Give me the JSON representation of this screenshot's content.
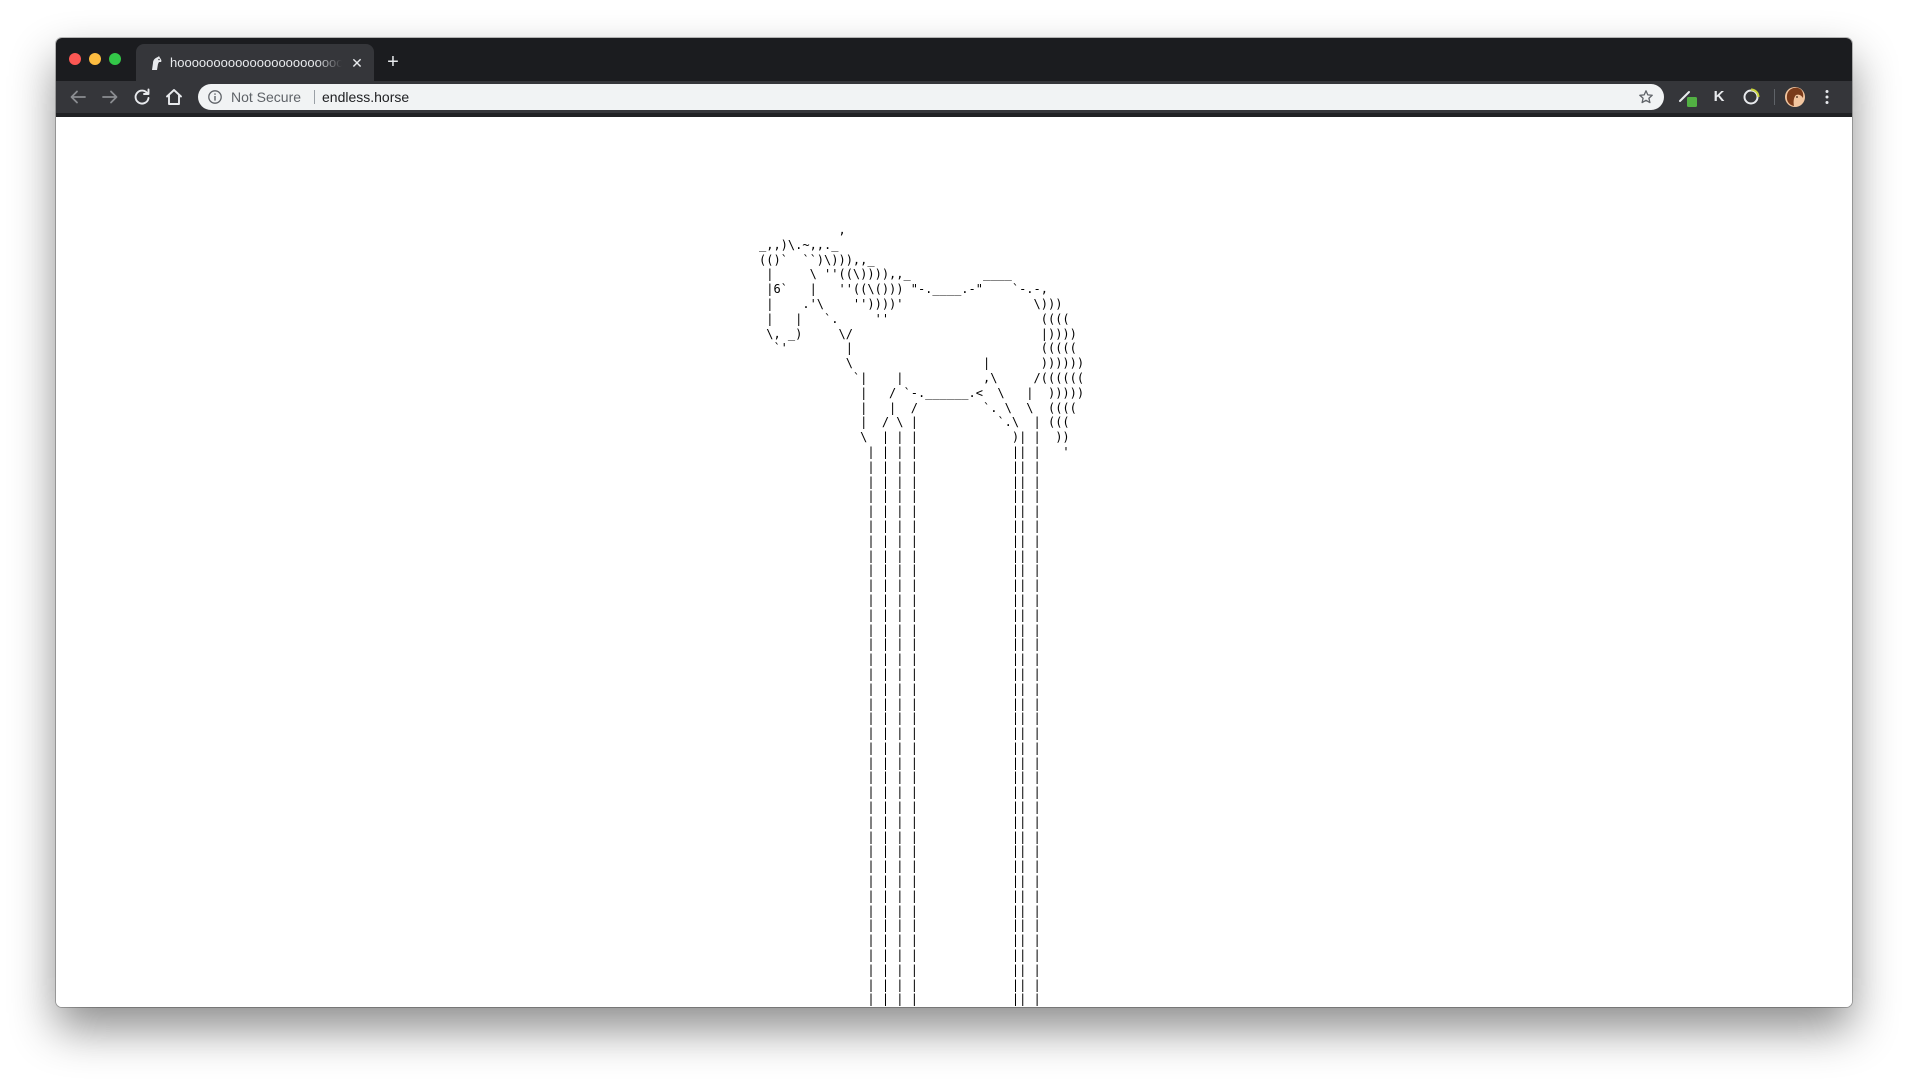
{
  "browser": {
    "tab": {
      "title": "hoooooooooooooooooooooooooooooooooooooooooooooorse",
      "favicon": "horse-head-icon",
      "close_icon": "close-icon"
    },
    "new_tab_icon": "plus-icon",
    "nav": {
      "back_icon": "arrow-left-icon",
      "forward_icon": "arrow-right-icon",
      "reload_icon": "reload-icon",
      "home_icon": "home-icon"
    },
    "omnibox": {
      "security_label": "Not Secure",
      "url": "endless.horse",
      "info_icon": "info-circle-icon",
      "bookmark_icon": "star-icon"
    },
    "extensions": {
      "ext1_icon": "pen-extension-icon",
      "ext2_label": "K",
      "ext3_icon": "circle-refresh-extension-icon",
      "profile_icon": "avatar-icon",
      "menu_icon": "kebab-menu-icon"
    },
    "colors": {
      "titlebar": "#1b1c1f",
      "toolbar": "#35363a",
      "omnibox": "#f1f3f4",
      "close": "#fc5753",
      "minimize": "#fdbc40",
      "maximize": "#33c748"
    }
  },
  "page": {
    "horse_art": "           ,\n_,,)\\.~,,._\n(()`  ``)\\))),,_\n |     \\ ''((\\)))),,_          ____\n |6`   |   ''((\\())) \"-.____.-\"    `-.-,\n |    .'\\    ''))))'                  \\)))\n |   |   `.     ''                     ((((\n \\, _)     \\/                          |))))\n  `'        |                          (((((\n            \\                  |       ))))))\n             `|    |           ,\\     /((((((\n              |   / `-.______.<  \\   |  )))))\n              |   |  /         `. \\  \\  ((((\n              |  / \\ |           `.\\  | (((\n              \\  | | |             )| |  ))\n               | | | |             || |   '",
    "leg_line": "               | | | |             || |",
    "leg_repeat": 40
  }
}
